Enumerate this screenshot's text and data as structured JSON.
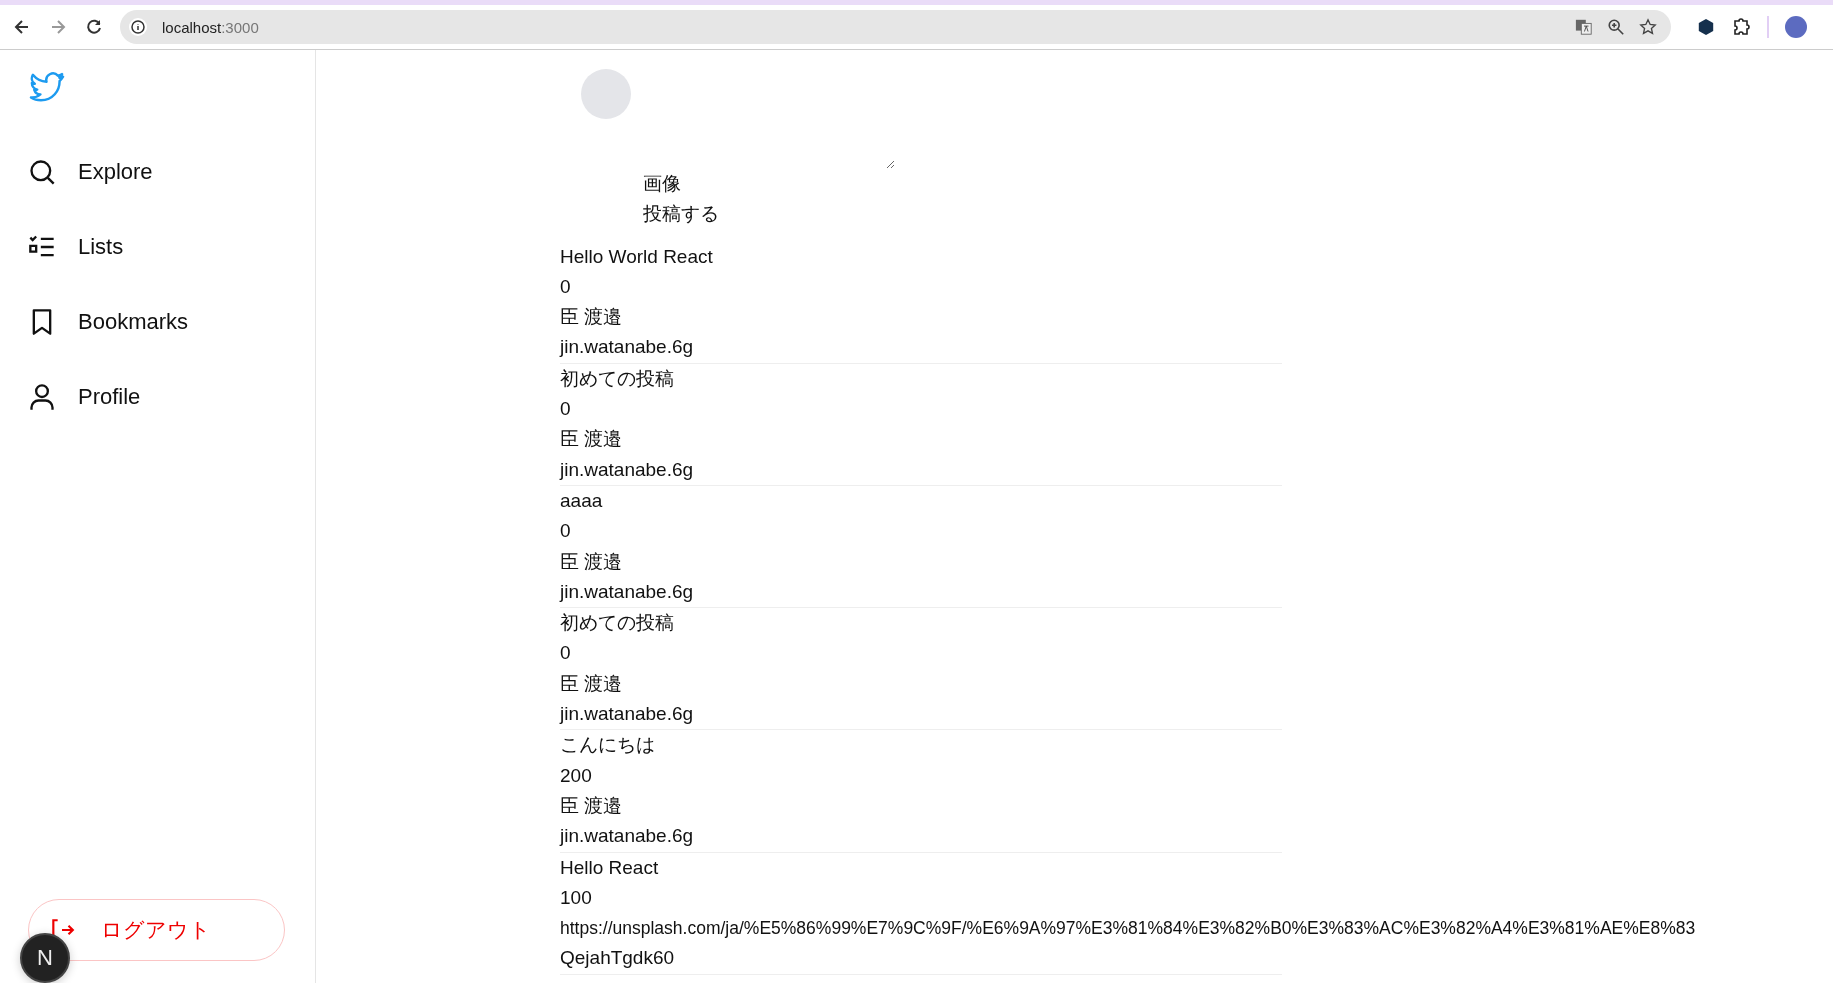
{
  "browser": {
    "url_host": "localhost",
    "url_port": ":3000"
  },
  "sidebar": {
    "items": [
      {
        "kind": "explore",
        "label": "Explore"
      },
      {
        "kind": "lists",
        "label": "Lists"
      },
      {
        "kind": "bookmarks",
        "label": "Bookmarks"
      },
      {
        "kind": "profile",
        "label": "Profile"
      }
    ],
    "logout": "ログアウト"
  },
  "dev_badge": {
    "label": "N"
  },
  "compose": {
    "image_label": "画像",
    "submit_label": "投稿する"
  },
  "posts": [
    {
      "content": "Hello World React",
      "likes": "0",
      "author": "臣 渡邉",
      "handle": "jin.watanabe.6g"
    },
    {
      "content": "初めての投稿",
      "likes": "0",
      "author": "臣 渡邉",
      "handle": "jin.watanabe.6g"
    },
    {
      "content": "aaaa",
      "likes": "0",
      "author": "臣 渡邉",
      "handle": "jin.watanabe.6g"
    },
    {
      "content": "初めての投稿",
      "likes": "0",
      "author": "臣 渡邉",
      "handle": "jin.watanabe.6g"
    },
    {
      "content": "こんにちは",
      "likes": "200",
      "author": "臣 渡邉",
      "handle": "jin.watanabe.6g"
    },
    {
      "content": "Hello React",
      "likes": "100",
      "image_url": "https://unsplash.com/ja/%E5%86%99%E7%9C%9F/%E6%9A%97%E3%81%84%E3%82%B0%E3%83%AC%E3%82%A4%E3%81%AE%E8%83",
      "image_id": "QejahTgdk60"
    }
  ]
}
